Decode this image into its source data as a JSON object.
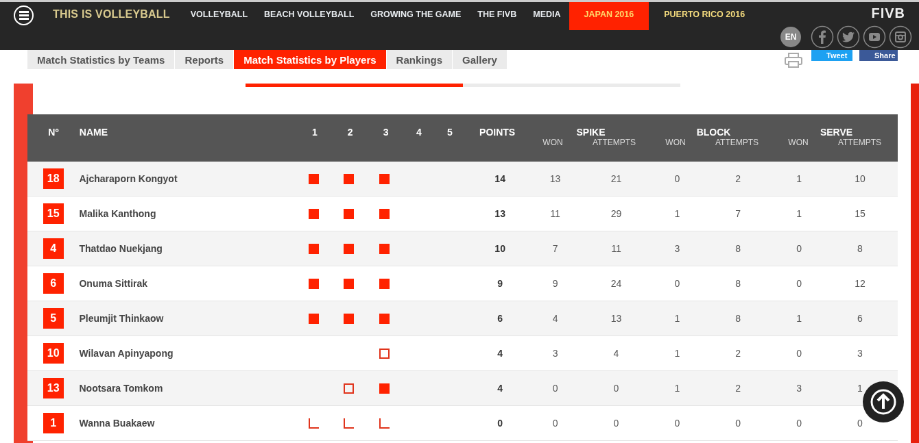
{
  "header": {
    "brand": "THIS IS VOLLEYBALL",
    "nav": [
      {
        "label": "VOLLEYBALL",
        "selected": false,
        "kind": "plain"
      },
      {
        "label": "BEACH VOLLEYBALL",
        "selected": false,
        "kind": "plain"
      },
      {
        "label": "GROWING THE GAME",
        "selected": false,
        "kind": "plain"
      },
      {
        "label": "THE FIVB",
        "selected": false,
        "kind": "plain"
      },
      {
        "label": "MEDIA",
        "selected": false,
        "kind": "plain"
      },
      {
        "label": "JAPAN 2016",
        "selected": true,
        "kind": "event"
      },
      {
        "label": "PUERTO RICO 2016",
        "selected": false,
        "kind": "event"
      }
    ],
    "logo": "FIVB",
    "language": "EN"
  },
  "tabs": [
    {
      "label": "Match Statistics by Teams",
      "selected": false
    },
    {
      "label": "Reports",
      "selected": false
    },
    {
      "label": "Match Statistics by Players",
      "selected": true
    },
    {
      "label": "Rankings",
      "selected": false
    },
    {
      "label": "Gallery",
      "selected": false
    }
  ],
  "share": {
    "tweet": "Tweet",
    "share": "Share"
  },
  "table": {
    "columns": {
      "number": "Nº",
      "name": "NAME",
      "sets": [
        "1",
        "2",
        "3",
        "4",
        "5"
      ],
      "points": "POINTS",
      "groups": [
        {
          "label": "SPIKE",
          "won": "WON",
          "attempts": "ATTEMPTS"
        },
        {
          "label": "BLOCK",
          "won": "WON",
          "attempts": "ATTEMPTS"
        },
        {
          "label": "SERVE",
          "won": "WON",
          "attempts": "ATTEMPTS"
        }
      ]
    },
    "rows": [
      {
        "number": "18",
        "name": "Ajcharaporn Kongyot",
        "sets": [
          {
            "kind": "full"
          },
          {
            "kind": "full"
          },
          {
            "kind": "full"
          }
        ],
        "points": "14",
        "stats": [
          "13",
          "21",
          "0",
          "2",
          "1",
          "10"
        ]
      },
      {
        "number": "15",
        "name": "Malika Kanthong",
        "sets": [
          {
            "kind": "full"
          },
          {
            "kind": "full"
          },
          {
            "kind": "full"
          }
        ],
        "points": "13",
        "stats": [
          "11",
          "29",
          "1",
          "7",
          "1",
          "15"
        ]
      },
      {
        "number": "4",
        "name": "Thatdao Nuekjang",
        "sets": [
          {
            "kind": "full"
          },
          {
            "kind": "full"
          },
          {
            "kind": "full"
          }
        ],
        "points": "10",
        "stats": [
          "7",
          "11",
          "3",
          "8",
          "0",
          "8"
        ]
      },
      {
        "number": "6",
        "name": "Onuma Sittirak",
        "sets": [
          {
            "kind": "full"
          },
          {
            "kind": "full"
          },
          {
            "kind": "full"
          }
        ],
        "points": "9",
        "stats": [
          "9",
          "24",
          "0",
          "8",
          "0",
          "12"
        ]
      },
      {
        "number": "5",
        "name": "Pleumjit Thinkaow",
        "sets": [
          {
            "kind": "full"
          },
          {
            "kind": "full"
          },
          {
            "kind": "full"
          }
        ],
        "points": "6",
        "stats": [
          "4",
          "13",
          "1",
          "8",
          "1",
          "6"
        ]
      },
      {
        "number": "10",
        "name": "Wilavan Apinyapong",
        "sets": [
          {
            "kind": "empty"
          },
          {
            "kind": "empty"
          },
          {
            "kind": "sub"
          }
        ],
        "points": "4",
        "stats": [
          "3",
          "4",
          "1",
          "2",
          "0",
          "3"
        ]
      },
      {
        "number": "13",
        "name": "Nootsara Tomkom",
        "sets": [
          {
            "kind": "empty"
          },
          {
            "kind": "sub"
          },
          {
            "kind": "full"
          }
        ],
        "points": "4",
        "stats": [
          "0",
          "0",
          "1",
          "2",
          "3",
          "1"
        ]
      },
      {
        "number": "1",
        "name": "Wanna Buakaew",
        "sets": [
          {
            "kind": "bench"
          },
          {
            "kind": "bench"
          },
          {
            "kind": "bench"
          }
        ],
        "points": "0",
        "stats": [
          "0",
          "0",
          "0",
          "0",
          "0",
          "0"
        ]
      }
    ]
  }
}
